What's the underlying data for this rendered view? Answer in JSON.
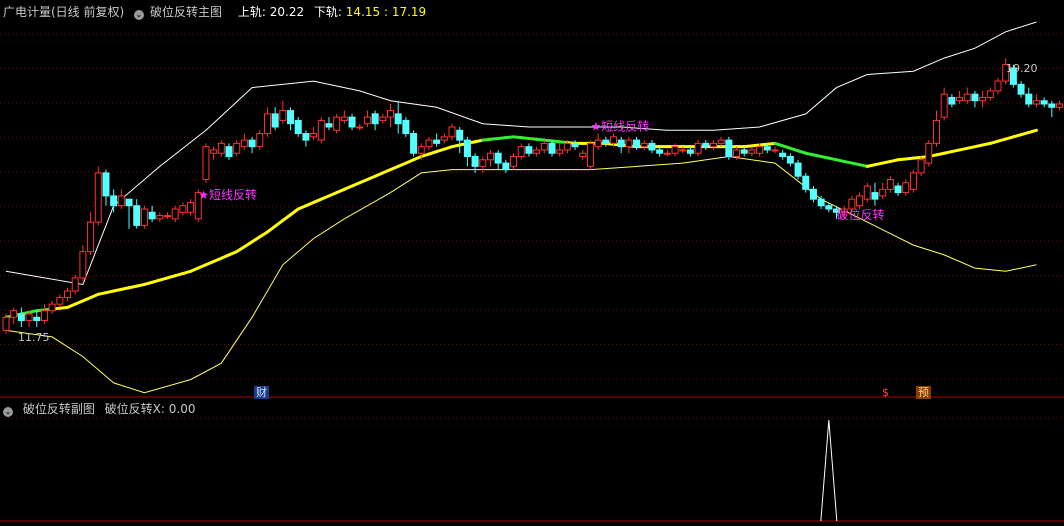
{
  "header": {
    "title": "广电计量(日线 前复权)",
    "indicator": "破位反转主图",
    "upper_label": "上轨:",
    "upper_value": "20.22",
    "lower_label": "下轨:",
    "lower_value": "14.15 : 17.19"
  },
  "sub_header": {
    "indicator": "破位反转副图",
    "value": "破位反转X: 0.00"
  },
  "badges": {
    "cai": "财",
    "dollar": "$",
    "yu": "预"
  },
  "colors": {
    "up": "#ff3232",
    "down": "#54ffff",
    "upper_band": "#ffffff",
    "lower_band": "#ffff66",
    "mid_up": "#ffff00",
    "mid_down": "#33ee33",
    "signal_text": "#ff33ff",
    "grid": "#7a0000"
  },
  "chart_data": {
    "type": "candlestick",
    "y_range": [
      10.2,
      21.6
    ],
    "max_label": "19.20",
    "min_label": "11.75",
    "annotations": [
      {
        "text": "★短线反转",
        "bar": 25,
        "price": 16.2
      },
      {
        "text": "★短线反转",
        "bar": 76,
        "price": 18.3
      },
      {
        "text": "破位反转",
        "bar": 108,
        "price": 15.6
      }
    ],
    "candles": [
      [
        12.2,
        12.6,
        12.1,
        12.7
      ],
      [
        12.6,
        12.8,
        12.4,
        12.9
      ],
      [
        12.7,
        12.5,
        12.3,
        12.9
      ],
      [
        12.5,
        12.7,
        12.3,
        12.8
      ],
      [
        12.6,
        12.5,
        12.3,
        12.8
      ],
      [
        12.5,
        12.8,
        12.4,
        13.0
      ],
      [
        12.8,
        13.0,
        12.7,
        13.1
      ],
      [
        13.0,
        13.2,
        12.9,
        13.3
      ],
      [
        13.2,
        13.4,
        13.1,
        13.5
      ],
      [
        13.4,
        13.8,
        13.3,
        13.9
      ],
      [
        13.8,
        14.6,
        13.7,
        14.8
      ],
      [
        14.6,
        15.5,
        14.5,
        15.8
      ],
      [
        15.5,
        17.0,
        15.4,
        17.2
      ],
      [
        17.0,
        16.3,
        16.0,
        17.1
      ],
      [
        16.3,
        16.0,
        15.8,
        16.5
      ],
      [
        16.0,
        16.3,
        15.9,
        16.5
      ],
      [
        16.2,
        16.0,
        15.3,
        16.1
      ],
      [
        16.0,
        15.4,
        15.3,
        16.2
      ],
      [
        15.4,
        15.9,
        15.3,
        16.0
      ],
      [
        15.8,
        15.6,
        15.5,
        16.0
      ],
      [
        15.6,
        15.7,
        15.5,
        15.8
      ],
      [
        15.7,
        15.7,
        15.6,
        15.8
      ],
      [
        15.6,
        15.9,
        15.5,
        16.0
      ],
      [
        15.8,
        16.0,
        15.7,
        16.1
      ],
      [
        15.8,
        16.1,
        15.7,
        16.2
      ],
      [
        15.6,
        16.4,
        15.5,
        16.5
      ],
      [
        16.8,
        17.8,
        16.7,
        17.9
      ],
      [
        17.6,
        17.7,
        17.4,
        17.8
      ],
      [
        17.6,
        17.9,
        17.5,
        18.0
      ],
      [
        17.8,
        17.5,
        17.4,
        17.9
      ],
      [
        17.6,
        17.9,
        17.5,
        18.0
      ],
      [
        17.8,
        18.0,
        17.7,
        18.2
      ],
      [
        18.0,
        17.8,
        17.6,
        18.1
      ],
      [
        17.8,
        18.2,
        17.7,
        18.3
      ],
      [
        18.2,
        18.8,
        18.1,
        19.0
      ],
      [
        18.8,
        18.4,
        18.3,
        19.0
      ],
      [
        18.6,
        18.9,
        18.5,
        19.2
      ],
      [
        18.9,
        18.5,
        18.3,
        19.0
      ],
      [
        18.6,
        18.2,
        18.1,
        18.7
      ],
      [
        18.2,
        18.0,
        17.8,
        18.3
      ],
      [
        18.1,
        18.2,
        18.0,
        18.4
      ],
      [
        18.0,
        18.6,
        17.9,
        18.7
      ],
      [
        18.5,
        18.4,
        18.3,
        18.7
      ],
      [
        18.3,
        18.7,
        18.2,
        18.8
      ],
      [
        18.6,
        18.7,
        18.5,
        18.9
      ],
      [
        18.7,
        18.4,
        18.3,
        18.8
      ],
      [
        18.4,
        18.4,
        18.3,
        18.5
      ],
      [
        18.5,
        18.7,
        18.4,
        18.9
      ],
      [
        18.8,
        18.5,
        18.3,
        18.9
      ],
      [
        18.6,
        18.7,
        18.5,
        18.8
      ],
      [
        18.7,
        18.9,
        18.4,
        19.1
      ],
      [
        18.8,
        18.5,
        18.2,
        19.2
      ],
      [
        18.6,
        18.2,
        18.1,
        18.7
      ],
      [
        18.2,
        17.6,
        17.5,
        18.3
      ],
      [
        17.6,
        17.8,
        17.4,
        17.9
      ],
      [
        17.8,
        18.0,
        17.7,
        18.1
      ],
      [
        18.0,
        17.9,
        17.8,
        18.2
      ],
      [
        18.0,
        18.1,
        17.9,
        18.2
      ],
      [
        18.1,
        18.4,
        18.0,
        18.5
      ],
      [
        18.3,
        18.0,
        17.6,
        18.4
      ],
      [
        18.0,
        17.5,
        17.2,
        18.1
      ],
      [
        17.5,
        17.2,
        17.0,
        17.6
      ],
      [
        17.2,
        17.4,
        17.0,
        17.5
      ],
      [
        17.4,
        17.6,
        17.2,
        17.7
      ],
      [
        17.6,
        17.3,
        17.1,
        17.7
      ],
      [
        17.3,
        17.1,
        17.0,
        17.4
      ],
      [
        17.2,
        17.5,
        17.1,
        17.6
      ],
      [
        17.5,
        17.8,
        17.4,
        17.9
      ],
      [
        17.8,
        17.6,
        17.5,
        17.9
      ],
      [
        17.6,
        17.7,
        17.5,
        17.8
      ],
      [
        17.7,
        17.9,
        17.6,
        18.0
      ],
      [
        17.9,
        17.6,
        17.5,
        18.0
      ],
      [
        17.6,
        17.7,
        17.5,
        17.9
      ],
      [
        17.7,
        17.9,
        17.6,
        18.0
      ],
      [
        17.9,
        17.8,
        17.7,
        18.0
      ],
      [
        17.5,
        17.6,
        17.4,
        17.7
      ],
      [
        17.2,
        17.9,
        17.1,
        18.0
      ],
      [
        17.8,
        18.0,
        17.7,
        18.2
      ],
      [
        18.0,
        17.9,
        17.8,
        18.1
      ],
      [
        17.9,
        18.1,
        17.8,
        18.2
      ],
      [
        18.0,
        17.8,
        17.6,
        18.1
      ],
      [
        17.8,
        18.0,
        17.6,
        18.1
      ],
      [
        18.0,
        17.8,
        17.7,
        18.1
      ],
      [
        17.8,
        17.9,
        17.7,
        18.0
      ],
      [
        17.9,
        17.7,
        17.6,
        18.0
      ],
      [
        17.7,
        17.6,
        17.5,
        17.8
      ],
      [
        17.6,
        17.6,
        17.5,
        17.7
      ],
      [
        17.6,
        17.8,
        17.5,
        17.9
      ],
      [
        17.7,
        17.7,
        17.6,
        17.8
      ],
      [
        17.7,
        17.6,
        17.5,
        17.8
      ],
      [
        17.6,
        17.9,
        17.5,
        18.0
      ],
      [
        17.9,
        17.8,
        17.7,
        18.0
      ],
      [
        17.8,
        17.9,
        17.7,
        18.0
      ],
      [
        17.9,
        18.0,
        17.8,
        18.1
      ],
      [
        18.0,
        17.5,
        17.4,
        18.1
      ],
      [
        17.5,
        17.7,
        17.4,
        17.8
      ],
      [
        17.7,
        17.6,
        17.5,
        17.8
      ],
      [
        17.6,
        17.7,
        17.5,
        17.8
      ],
      [
        17.6,
        17.8,
        17.5,
        17.9
      ],
      [
        17.8,
        17.7,
        17.6,
        17.9
      ],
      [
        17.7,
        17.7,
        17.6,
        17.8
      ],
      [
        17.6,
        17.5,
        17.4,
        17.7
      ],
      [
        17.5,
        17.3,
        17.2,
        17.6
      ],
      [
        17.3,
        16.9,
        16.8,
        17.4
      ],
      [
        16.9,
        16.5,
        16.4,
        17.0
      ],
      [
        16.5,
        16.2,
        16.1,
        16.6
      ],
      [
        16.2,
        16.0,
        15.9,
        16.3
      ],
      [
        16.0,
        15.9,
        15.8,
        16.1
      ],
      [
        15.9,
        15.8,
        15.6,
        16.0
      ],
      [
        15.8,
        15.9,
        15.6,
        16.0
      ],
      [
        15.9,
        16.2,
        15.8,
        16.3
      ],
      [
        16.0,
        16.3,
        15.9,
        16.4
      ],
      [
        16.2,
        16.6,
        16.1,
        16.7
      ],
      [
        16.4,
        16.2,
        16.0,
        16.7
      ],
      [
        16.3,
        16.5,
        16.2,
        16.7
      ],
      [
        16.5,
        16.8,
        16.4,
        16.9
      ],
      [
        16.6,
        16.4,
        16.3,
        16.7
      ],
      [
        16.4,
        16.7,
        16.3,
        16.8
      ],
      [
        16.5,
        17.0,
        16.4,
        17.1
      ],
      [
        17.0,
        17.4,
        16.9,
        17.5
      ],
      [
        17.3,
        17.9,
        17.2,
        18.0
      ],
      [
        17.9,
        18.6,
        17.8,
        18.9
      ],
      [
        18.7,
        19.4,
        18.6,
        19.6
      ],
      [
        19.3,
        19.1,
        19.0,
        19.4
      ],
      [
        19.2,
        19.3,
        19.1,
        19.5
      ],
      [
        19.2,
        19.4,
        19.1,
        19.6
      ],
      [
        19.4,
        19.2,
        19.0,
        19.5
      ],
      [
        19.2,
        19.3,
        19.0,
        19.5
      ],
      [
        19.3,
        19.5,
        19.2,
        19.6
      ],
      [
        19.5,
        19.8,
        19.4,
        19.9
      ],
      [
        19.8,
        20.3,
        19.7,
        20.5
      ],
      [
        20.2,
        19.7,
        19.6,
        20.3
      ],
      [
        19.7,
        19.4,
        19.3,
        19.8
      ],
      [
        19.4,
        19.1,
        19.0,
        19.6
      ],
      [
        19.1,
        19.2,
        19.0,
        19.4
      ],
      [
        19.2,
        19.1,
        19.0,
        19.3
      ],
      [
        19.1,
        19.0,
        18.7,
        19.2
      ],
      [
        19.0,
        19.1,
        18.9,
        19.2
      ]
    ],
    "upper_band": [
      [
        0,
        14.0
      ],
      [
        10,
        13.6
      ],
      [
        14,
        16.0
      ],
      [
        20,
        17.2
      ],
      [
        26,
        18.3
      ],
      [
        32,
        19.6
      ],
      [
        40,
        19.8
      ],
      [
        46,
        19.5
      ],
      [
        50,
        19.2
      ],
      [
        56,
        19.0
      ],
      [
        62,
        18.5
      ],
      [
        68,
        18.4
      ],
      [
        74,
        18.4
      ],
      [
        80,
        18.4
      ],
      [
        86,
        18.3
      ],
      [
        92,
        18.3
      ],
      [
        98,
        18.4
      ],
      [
        104,
        18.8
      ],
      [
        108,
        19.6
      ],
      [
        112,
        20.0
      ],
      [
        118,
        20.1
      ],
      [
        122,
        20.5
      ],
      [
        126,
        20.8
      ],
      [
        130,
        21.3
      ],
      [
        134,
        21.6
      ]
    ],
    "lower_band": [
      [
        0,
        12.2
      ],
      [
        6,
        12.0
      ],
      [
        10,
        11.4
      ],
      [
        14,
        10.6
      ],
      [
        18,
        10.3
      ],
      [
        24,
        10.7
      ],
      [
        28,
        11.2
      ],
      [
        32,
        12.6
      ],
      [
        36,
        14.2
      ],
      [
        40,
        15.0
      ],
      [
        44,
        15.6
      ],
      [
        50,
        16.4
      ],
      [
        54,
        17.0
      ],
      [
        58,
        17.1
      ],
      [
        64,
        17.1
      ],
      [
        70,
        17.1
      ],
      [
        76,
        17.1
      ],
      [
        82,
        17.2
      ],
      [
        88,
        17.3
      ],
      [
        94,
        17.5
      ],
      [
        100,
        17.3
      ],
      [
        106,
        16.2
      ],
      [
        112,
        15.5
      ],
      [
        118,
        14.8
      ],
      [
        122,
        14.5
      ],
      [
        126,
        14.1
      ],
      [
        130,
        14.0
      ],
      [
        134,
        14.2
      ]
    ],
    "mid_line": [
      [
        0,
        12.6
      ],
      [
        4,
        12.8
      ],
      [
        8,
        12.9
      ],
      [
        12,
        13.3
      ],
      [
        18,
        13.6
      ],
      [
        24,
        14.0
      ],
      [
        30,
        14.6
      ],
      [
        34,
        15.2
      ],
      [
        38,
        15.9
      ],
      [
        42,
        16.3
      ],
      [
        46,
        16.7
      ],
      [
        50,
        17.1
      ],
      [
        54,
        17.5
      ],
      [
        58,
        17.8
      ],
      [
        62,
        18.0
      ],
      [
        66,
        18.1
      ],
      [
        70,
        18.0
      ],
      [
        74,
        17.9
      ],
      [
        78,
        17.9
      ],
      [
        82,
        17.8
      ],
      [
        86,
        17.8
      ],
      [
        90,
        17.8
      ],
      [
        96,
        17.8
      ],
      [
        100,
        17.9
      ],
      [
        104,
        17.6
      ],
      [
        108,
        17.4
      ],
      [
        112,
        17.2
      ],
      [
        116,
        17.4
      ],
      [
        120,
        17.5
      ],
      [
        124,
        17.7
      ],
      [
        128,
        17.9
      ],
      [
        134,
        18.3
      ]
    ],
    "mid_line_down_segments": [
      [
        0,
        6
      ],
      [
        62,
        73
      ],
      [
        100,
        112
      ]
    ],
    "sub_signal": {
      "bar": 107,
      "value": 1
    }
  }
}
